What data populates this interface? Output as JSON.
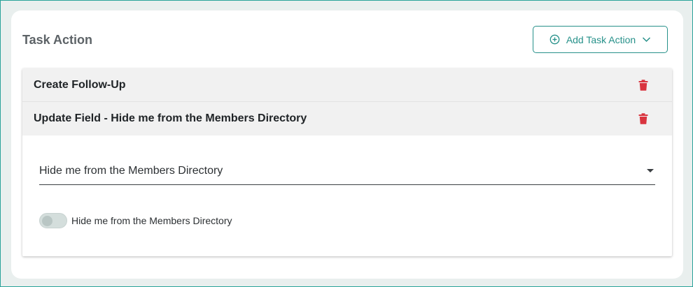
{
  "section": {
    "title": "Task Action",
    "add_button_label": "Add Task Action",
    "add_button_icon": "plus-circle-icon",
    "dropdown_icon": "chevron-down-icon"
  },
  "task_actions": [
    {
      "label": "Create Follow-Up",
      "delete_icon": "trash-icon"
    },
    {
      "label": "Update Field - Hide me from the Members Directory",
      "delete_icon": "trash-icon"
    }
  ],
  "field_editor": {
    "select_value": "Hide me from the Members Directory",
    "toggle_label": "Hide me from the Members Directory",
    "toggle_on": false
  },
  "colors": {
    "accent": "#27918a",
    "danger": "#d9343f",
    "frame_border": "#2aa39a"
  }
}
